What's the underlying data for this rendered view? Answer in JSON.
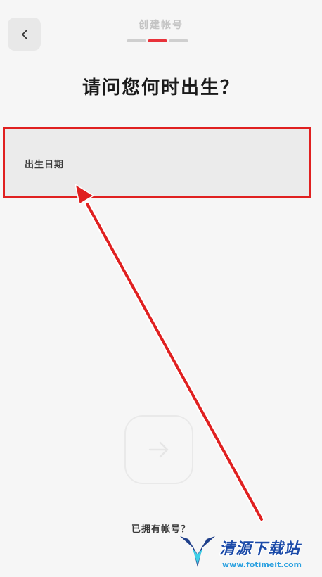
{
  "header": {
    "back_icon": "chevron-left-icon",
    "step_title": "创建帐号",
    "progress": {
      "total_steps": 3,
      "current_step": 2,
      "active_color": "#e8323a"
    }
  },
  "question": {
    "title": "请问您何时出生？"
  },
  "birthday_field": {
    "label": "出生日期",
    "highlight_color": "#e02020"
  },
  "next_button": {
    "icon": "arrow-right-icon",
    "enabled": false
  },
  "footer": {
    "login_link": "已拥有帐号？"
  },
  "annotation": {
    "arrow_color": "#e02020"
  },
  "watermark": {
    "name": "清源下载站",
    "url": "www.fotimeit.com"
  }
}
